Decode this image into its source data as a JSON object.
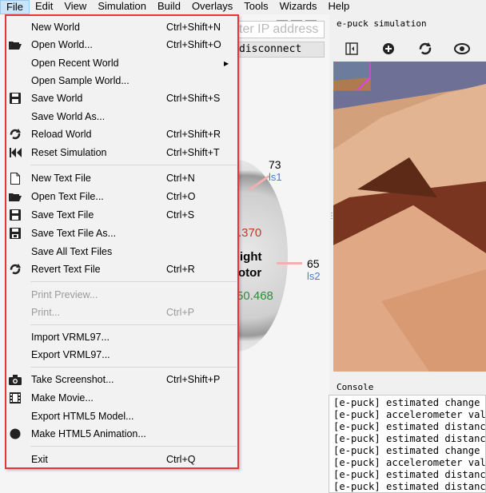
{
  "menubar": {
    "items": [
      "File",
      "Edit",
      "View",
      "Simulation",
      "Build",
      "Overlays",
      "Tools",
      "Wizards",
      "Help"
    ]
  },
  "robot_window": {
    "ip_placeholder": "Enter IP address",
    "ip_placeholder_visible": "ter IP address",
    "disconnect_label": "disconnect",
    "sensor_top_value": "73",
    "sensor_top_name": "ls1",
    "sensor_right_value": "65",
    "sensor_right_name": "ls2",
    "motor_label_line1": "ight",
    "motor_label_line2": "otor",
    "speed_value_partial": ".370",
    "position_value_partial": "50.468",
    "colors": {
      "speed": "#c0392b",
      "position": "#2e8b3a",
      "sensor_name": "#4b7bd2"
    }
  },
  "simulation": {
    "title": "e-puck simulation",
    "toolbar_icons": [
      "panel-toggle-icon",
      "add-node-icon",
      "reload-icon",
      "eye-icon"
    ]
  },
  "console": {
    "title": "Console",
    "lines": [
      "[e-puck] estimated change of",
      "[e-puck] accelerometer value",
      "[e-puck] estimated distance",
      "[e-puck] estimated distance",
      "[e-puck] estimated change of",
      "[e-puck] accelerometer value",
      "[e-puck] estimated distance",
      "[e-puck] estimated distance"
    ]
  },
  "file_menu": {
    "highlight_color": "#e53535",
    "groups": [
      [
        {
          "label": "New World",
          "shortcut": "Ctrl+Shift+N",
          "icon": "",
          "enabled": true
        },
        {
          "label": "Open World...",
          "shortcut": "Ctrl+Shift+O",
          "icon": "folder-icon",
          "enabled": true
        },
        {
          "label": "Open Recent World",
          "shortcut": "",
          "icon": "",
          "enabled": true,
          "submenu": true
        },
        {
          "label": "Open Sample World...",
          "shortcut": "",
          "icon": "",
          "enabled": true
        },
        {
          "label": "Save World",
          "shortcut": "Ctrl+Shift+S",
          "icon": "floppy-icon",
          "enabled": true
        },
        {
          "label": "Save World As...",
          "shortcut": "",
          "icon": "",
          "enabled": true
        },
        {
          "label": "Reload World",
          "shortcut": "Ctrl+Shift+R",
          "icon": "reload-icon",
          "enabled": true
        },
        {
          "label": "Reset Simulation",
          "shortcut": "Ctrl+Shift+T",
          "icon": "rewind-icon",
          "enabled": true
        }
      ],
      [
        {
          "label": "New Text File",
          "shortcut": "Ctrl+N",
          "icon": "document-icon",
          "enabled": true
        },
        {
          "label": "Open Text File...",
          "shortcut": "Ctrl+O",
          "icon": "folder-icon",
          "enabled": true
        },
        {
          "label": "Save Text File",
          "shortcut": "Ctrl+S",
          "icon": "floppy-icon",
          "enabled": true
        },
        {
          "label": "Save Text File As...",
          "shortcut": "",
          "icon": "floppy-as-icon",
          "enabled": true
        },
        {
          "label": "Save All Text Files",
          "shortcut": "",
          "icon": "",
          "enabled": true
        },
        {
          "label": "Revert Text File",
          "shortcut": "Ctrl+R",
          "icon": "reload-icon",
          "enabled": true
        }
      ],
      [
        {
          "label": "Print Preview...",
          "shortcut": "",
          "icon": "",
          "enabled": false
        },
        {
          "label": "Print...",
          "shortcut": "Ctrl+P",
          "icon": "",
          "enabled": false
        }
      ],
      [
        {
          "label": "Import VRML97...",
          "shortcut": "",
          "icon": "",
          "enabled": true
        },
        {
          "label": "Export VRML97...",
          "shortcut": "",
          "icon": "",
          "enabled": true
        }
      ],
      [
        {
          "label": "Take Screenshot...",
          "shortcut": "Ctrl+Shift+P",
          "icon": "camera-icon",
          "enabled": true
        },
        {
          "label": "Make Movie...",
          "shortcut": "",
          "icon": "film-icon",
          "enabled": true
        },
        {
          "label": "Export HTML5 Model...",
          "shortcut": "",
          "icon": "",
          "enabled": true
        },
        {
          "label": "Make HTML5 Animation...",
          "shortcut": "",
          "icon": "record-icon",
          "enabled": true
        }
      ],
      [
        {
          "label": "Exit",
          "shortcut": "Ctrl+Q",
          "icon": "",
          "enabled": true
        }
      ]
    ]
  }
}
